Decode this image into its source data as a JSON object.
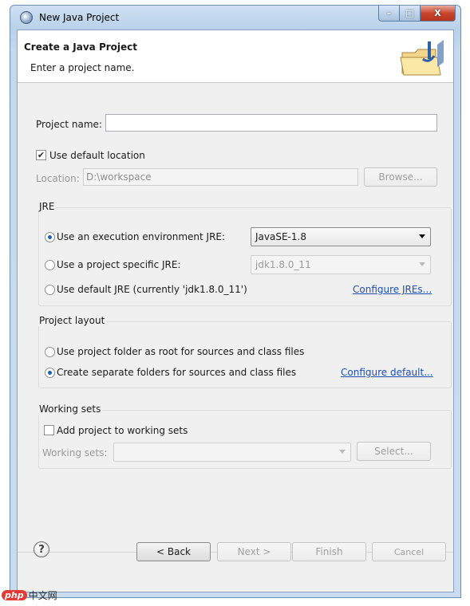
{
  "window": {
    "title": "New Java Project",
    "controls": {
      "minimize": "–",
      "maximize": "□",
      "close": "X"
    }
  },
  "banner": {
    "title": "Create a Java Project",
    "description": "Enter a project name.",
    "icon": "java-project-folder-icon"
  },
  "project_name": {
    "label": "Project name:",
    "value": ""
  },
  "location": {
    "use_default_label": "Use default location",
    "use_default_checked": true,
    "label": "Location:",
    "value": "D:\\workspace",
    "browse_label": "Browse..."
  },
  "jre": {
    "group_title": "JRE",
    "options": [
      {
        "label": "Use an execution environment JRE:",
        "selected": true
      },
      {
        "label": "Use a project specific JRE:",
        "selected": false
      },
      {
        "label": "Use default JRE (currently 'jdk1.8.0_11')",
        "selected": false
      }
    ],
    "execution_env_value": "JavaSE-1.8",
    "project_jre_value": "jdk1.8.0_11",
    "configure_link": "Configure JREs..."
  },
  "layout": {
    "group_title": "Project layout",
    "options": [
      {
        "label": "Use project folder as root for sources and class files",
        "selected": false
      },
      {
        "label": "Create separate folders for sources and class files",
        "selected": true
      }
    ],
    "configure_link": "Configure default..."
  },
  "working_sets": {
    "group_title": "Working sets",
    "add_label": "Add project to working sets",
    "add_checked": false,
    "label": "Working sets:",
    "value": "",
    "select_label": "Select..."
  },
  "footer": {
    "help": "?",
    "back_label": "< Back",
    "next_label": "Next >",
    "finish_label": "Finish",
    "cancel_label": "Cancel"
  },
  "watermark": {
    "logo": "php",
    "text": "中文网"
  },
  "colors": {
    "link": "#1f4fb5",
    "radio_selected": "#1f5fb4",
    "window_frame": "#b9d1ea"
  }
}
